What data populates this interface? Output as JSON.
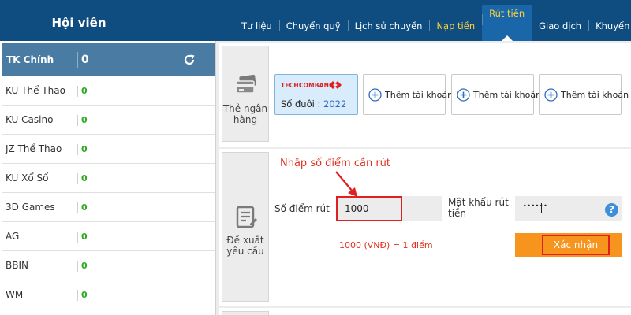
{
  "header": {
    "title": "Hội viên",
    "nav": [
      "Tư liệu",
      "Chuyển quỹ",
      "Lịch sử chuyển",
      "Nạp tiền",
      "Rút tiền",
      "Giao dịch",
      "Khuyến mãi"
    ]
  },
  "sidebar": {
    "main": {
      "label": "TK Chính",
      "value": "0"
    },
    "items": [
      {
        "label": "KU Thể Thao",
        "value": "0"
      },
      {
        "label": "KU Casino",
        "value": "0"
      },
      {
        "label": "JZ Thể Thao",
        "value": "0"
      },
      {
        "label": "KU Xổ Số",
        "value": "0"
      },
      {
        "label": "3D Games",
        "value": "0"
      },
      {
        "label": "AG",
        "value": "0"
      },
      {
        "label": "BBIN",
        "value": "0"
      },
      {
        "label": "WM",
        "value": "0"
      }
    ]
  },
  "bank_section": {
    "label_line1": "Thẻ ngân",
    "label_line2": "hàng",
    "selected_card": {
      "bank_name": "TECHCOMBANK",
      "suffix_label": "Số đuôi :",
      "suffix_value": "2022"
    },
    "add_label": "Thêm tài khoản"
  },
  "request_section": {
    "label_line1": "Đề xuất",
    "label_line2": "yêu cầu",
    "annotation": "Nhập số điểm cần rút",
    "amount_label": "Số điểm rút",
    "amount_value": "1000",
    "password_label_line1": "Mật khẩu rút",
    "password_label_line2": "tiền",
    "password_mask": "••••••",
    "help_icon": "?",
    "rate_text": "1000 (VNĐ) = 1 điểm",
    "confirm_label": "Xác nhận"
  },
  "colors": {
    "header_bg": "#0f4d80",
    "active_tab_bg": "#1967a8",
    "highlight_text": "#ffd23f",
    "sidebar_active_bg": "#4a7ba3",
    "balance_green": "#2eaa1f",
    "annotation_red": "#e02020",
    "confirm_orange": "#f7941d"
  },
  "icons": [
    "refresh-icon",
    "bank-card-icon",
    "plus-circle-icon",
    "form-icon",
    "arrow-icon",
    "help-icon"
  ]
}
